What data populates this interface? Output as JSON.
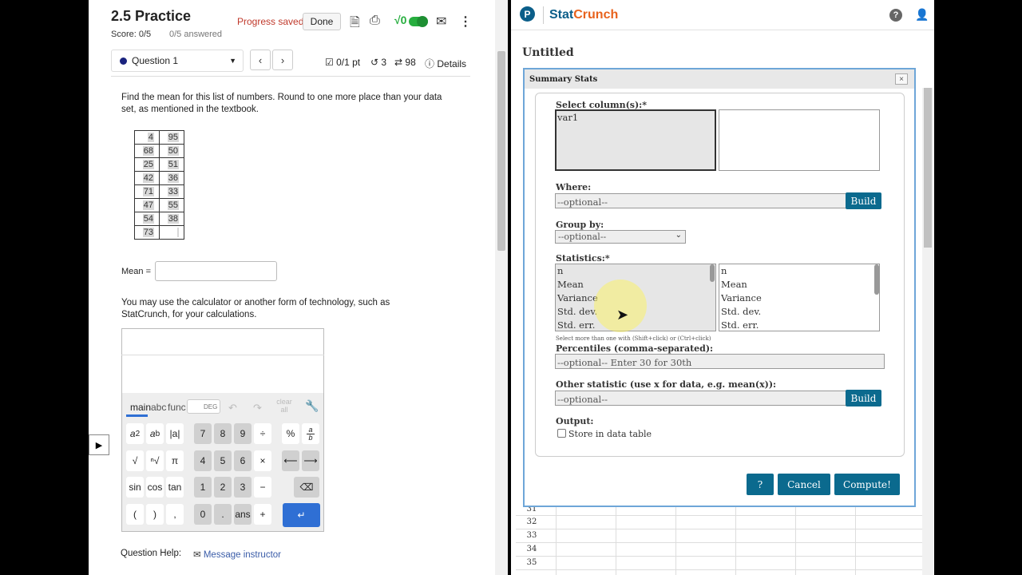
{
  "left": {
    "title": "2.5 Practice",
    "score": "Score: 0/5",
    "answered": "0/5 answered",
    "progress": "Progress saved",
    "done": "Done",
    "question": "Question 1",
    "points": "0/1 pt",
    "retries": "3",
    "attempts": "98",
    "details": "Details",
    "problem": "Find the mean for this list of numbers. Round to one more place than your data set, as mentioned in the textbook.",
    "data_rows": [
      [
        "4",
        "95"
      ],
      [
        "68",
        "50"
      ],
      [
        "25",
        "51"
      ],
      [
        "42",
        "36"
      ],
      [
        "71",
        "33"
      ],
      [
        "47",
        "55"
      ],
      [
        "54",
        "38"
      ],
      [
        "73",
        ""
      ]
    ],
    "mean_label": "Mean =",
    "calc_note": "You may use the calculator or another form of technology, such as StatCrunch, for your calculations.",
    "tabs": {
      "main": "main",
      "abc": "abc",
      "func": "func",
      "deg": "DEG",
      "clear": "clear all"
    },
    "keys": {
      "r1": [
        "7",
        "8",
        "9",
        "÷",
        "%"
      ],
      "r2": [
        "π",
        "4",
        "5",
        "6",
        "×"
      ],
      "r3": [
        "sin",
        "cos",
        "tan",
        "1",
        "2",
        "3",
        "−"
      ],
      "r4": [
        "(",
        ")",
        ",",
        "0",
        ".",
        "ans",
        "+"
      ],
      "abs": "|a|",
      "sqrt": "√",
      "nroot": "ⁿ√"
    },
    "help_label": "Question Help:",
    "message": "Message instructor"
  },
  "right": {
    "brand_stat": "Stat",
    "brand_crunch": "Crunch",
    "logo": "P",
    "untitled": "Untitled",
    "dialog_title": "Summary Stats",
    "close": "×",
    "select_columns": "Select column(s):*",
    "columns": [
      "var1"
    ],
    "where": "Where:",
    "where_ph": "--optional--",
    "build": "Build",
    "group_by": "Group by:",
    "group_val": "--optional--",
    "statistics": "Statistics:*",
    "stats_left": [
      "n",
      "Mean",
      "Variance",
      "Std. dev.",
      "Std. err."
    ],
    "stats_right": [
      "n",
      "Mean",
      "Variance",
      "Std. dev.",
      "Std. err."
    ],
    "hint": "Select more than one with (Shift+click) or (Ctrl+click)",
    "percentiles": "Percentiles (comma-separated):",
    "percentiles_ph": "--optional-- Enter 30 for 30th",
    "other": "Other statistic (use x for data, e.g. mean(x)):",
    "other_ph": "--optional--",
    "output": "Output:",
    "store": "Store in data table",
    "help_btn": "?",
    "cancel": "Cancel",
    "compute": "Compute!",
    "rows": [
      "31",
      "32",
      "33",
      "34",
      "35"
    ]
  },
  "colors": {
    "brand_blue": "#0b5e89",
    "brand_orange": "#e8621c",
    "button": "#0b6a8e",
    "accent_green": "#27ae3f"
  }
}
